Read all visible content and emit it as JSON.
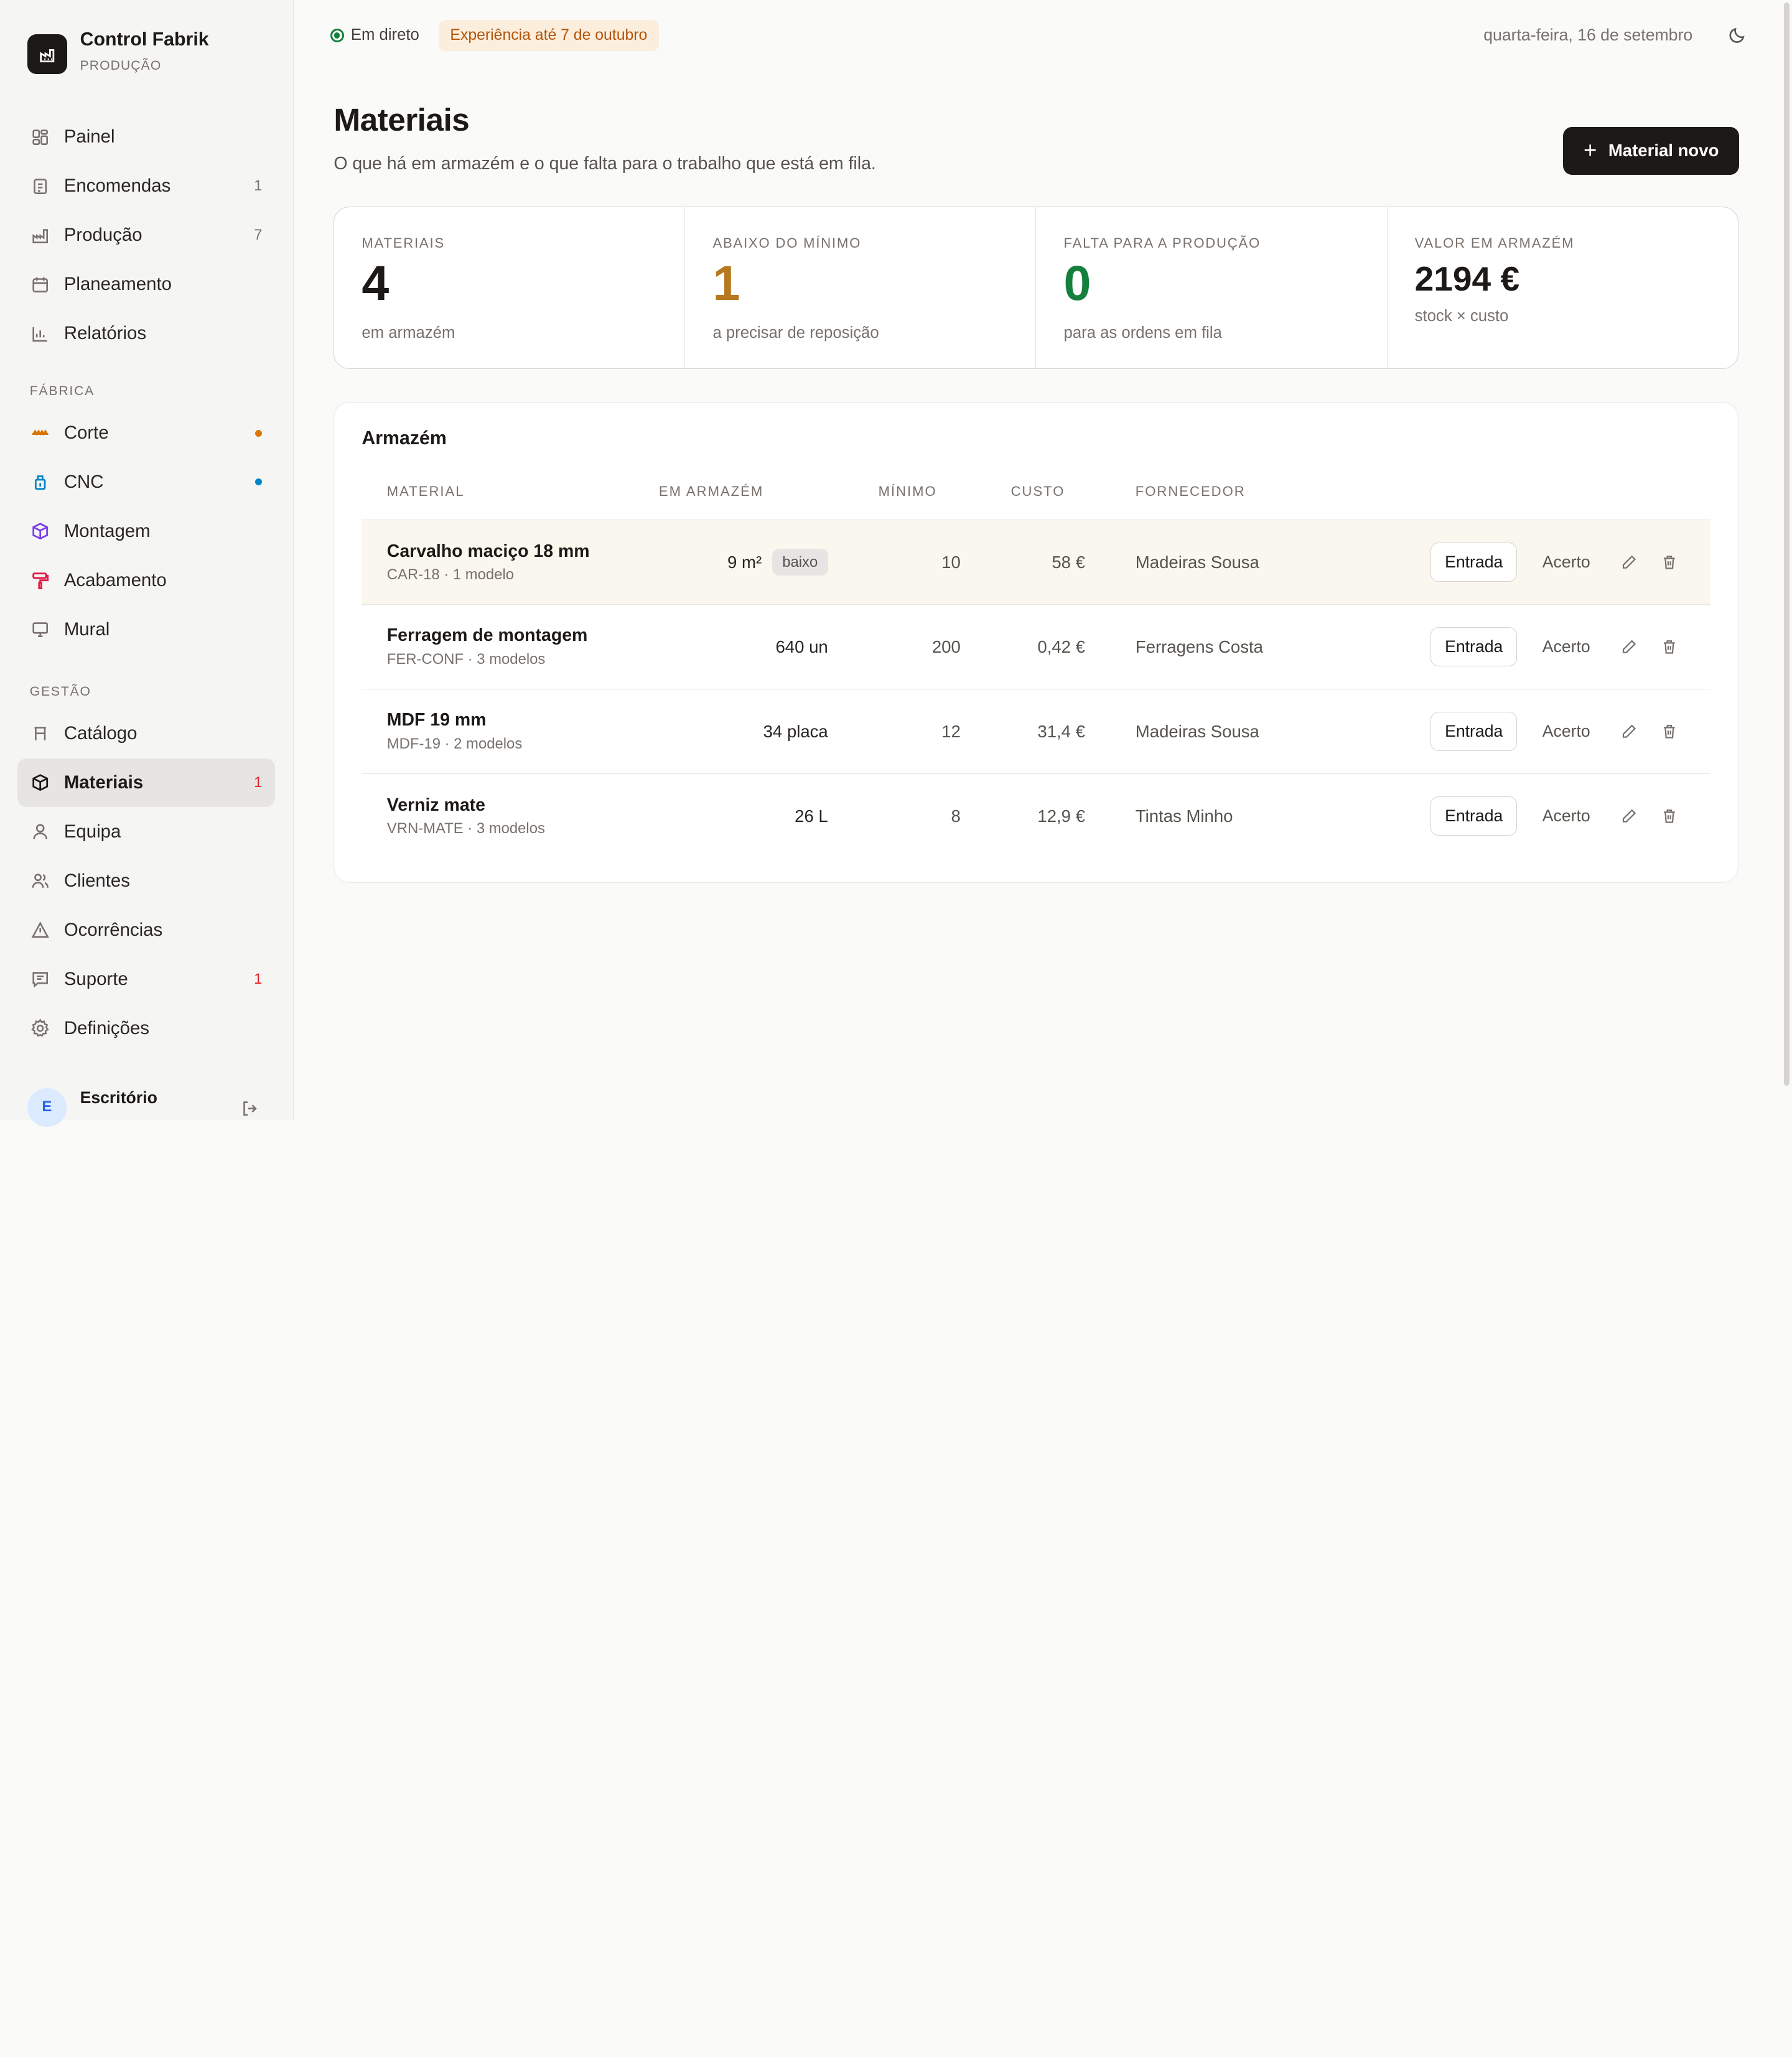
{
  "brand": {
    "name": "Control Fabrik",
    "subtitle": "PRODUÇÃO"
  },
  "nav_main": [
    {
      "label": "Painel",
      "icon": "dashboard-icon",
      "count": ""
    },
    {
      "label": "Encomendas",
      "icon": "orders-icon",
      "count": "1"
    },
    {
      "label": "Produção",
      "icon": "factory-icon",
      "count": "7"
    },
    {
      "label": "Planeamento",
      "icon": "calendar-icon",
      "count": ""
    },
    {
      "label": "Relatórios",
      "icon": "bar-chart-icon",
      "count": ""
    }
  ],
  "section_factory": "FÁBRICA",
  "nav_factory": [
    {
      "label": "Corte",
      "icon": "saw-icon",
      "dot_color": "#d97706"
    },
    {
      "label": "CNC",
      "icon": "cnc-icon",
      "dot_color": "#0284c7"
    },
    {
      "label": "Montagem",
      "icon": "cube-icon",
      "dot_color": ""
    },
    {
      "label": "Acabamento",
      "icon": "paint-roller-icon",
      "dot_color": ""
    },
    {
      "label": "Mural",
      "icon": "monitor-icon",
      "dot_color": ""
    }
  ],
  "section_management": "GESTÃO",
  "nav_management": [
    {
      "label": "Catálogo",
      "icon": "catalog-icon",
      "count": ""
    },
    {
      "label": "Materiais",
      "icon": "box-icon",
      "count": "1",
      "active": true
    },
    {
      "label": "Equipa",
      "icon": "user-icon",
      "count": ""
    },
    {
      "label": "Clientes",
      "icon": "users-icon",
      "count": ""
    },
    {
      "label": "Ocorrências",
      "icon": "warning-icon",
      "count": ""
    },
    {
      "label": "Suporte",
      "icon": "message-icon",
      "count": "1"
    },
    {
      "label": "Definições",
      "icon": "gear-icon",
      "count": ""
    }
  ],
  "user": {
    "initial": "E",
    "name": "Escritório"
  },
  "topbar": {
    "live_label": "Em direto",
    "trial_label": "Experiência até 7 de outubro",
    "date": "quarta-feira, 16 de setembro"
  },
  "page": {
    "title": "Materiais",
    "subtitle": "O que há em armazém e o que falta para o trabalho que está em fila.",
    "primary_button": "Material novo"
  },
  "stats": [
    {
      "label": "MATERIAIS",
      "value": "4",
      "hint": "em armazém",
      "color": "#1c1917"
    },
    {
      "label": "ABAIXO DO MÍNIMO",
      "value": "1",
      "hint": "a precisar de reposição",
      "color": "#b7791f"
    },
    {
      "label": "FALTA PARA A PRODUÇÃO",
      "value": "0",
      "hint": "para as ordens em fila",
      "color": "#15803d"
    },
    {
      "label": "VALOR EM ARMAZÉM",
      "value": "2194 €",
      "hint": "stock × custo",
      "color": "#1c1917"
    }
  ],
  "warehouse": {
    "title": "Armazém",
    "columns": {
      "material": "MATERIAL",
      "stock": "EM ARMAZÉM",
      "minimum": "MÍNIMO",
      "cost": "CUSTO",
      "supplier": "FORNECEDOR"
    },
    "actions": {
      "in": "Entrada",
      "adjust": "Acerto"
    },
    "rows": [
      {
        "name": "Carvalho maciço 18 mm",
        "sub": "CAR-18 · 1 modelo",
        "stock": "9 m²",
        "badge": "baixo",
        "minimum": "10",
        "cost": "58 €",
        "supplier": "Madeiras Sousa"
      },
      {
        "name": "Ferragem de montagem",
        "sub": "FER-CONF · 3 modelos",
        "stock": "640 un",
        "badge": "",
        "minimum": "200",
        "cost": "0,42 €",
        "supplier": "Ferragens Costa"
      },
      {
        "name": "MDF 19 mm",
        "sub": "MDF-19 · 2 modelos",
        "stock": "34 placa",
        "badge": "",
        "minimum": "12",
        "cost": "31,4 €",
        "supplier": "Madeiras Sousa"
      },
      {
        "name": "Verniz mate",
        "sub": "VRN-MATE · 3 modelos",
        "stock": "26 L",
        "badge": "",
        "minimum": "8",
        "cost": "12,9 €",
        "supplier": "Tintas Minho"
      }
    ]
  }
}
